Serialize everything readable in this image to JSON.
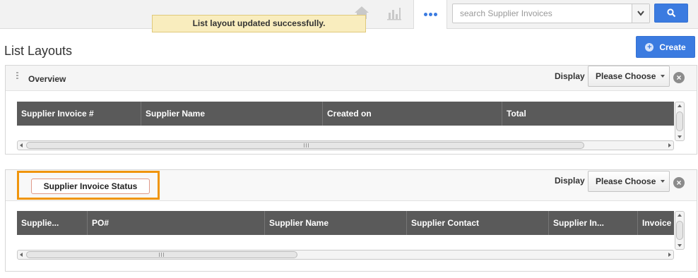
{
  "topbar": {
    "home_icon": "home-icon",
    "chart_icon": "bar-chart-icon",
    "more_icon": "more-dots-icon",
    "search_placeholder": "search Supplier Invoices",
    "search_icon": "search-icon",
    "accent_color": "#3b7be0"
  },
  "toast": {
    "message": "List layout updated successfully."
  },
  "page": {
    "title": "List Layouts",
    "create_label": "Create"
  },
  "panels": [
    {
      "name": "Overview",
      "display_label": "Display",
      "display_value": "Please Choose",
      "columns": [
        "Supplier Invoice #",
        "Supplier Name",
        "Created on",
        "Total"
      ]
    },
    {
      "name": "Supplier Invoice Status",
      "display_label": "Display",
      "display_value": "Please Choose",
      "columns": [
        "Supplie...",
        "PO#",
        "Supplier Name",
        "Supplier Contact",
        "Supplier In...",
        "Invoice"
      ]
    }
  ]
}
